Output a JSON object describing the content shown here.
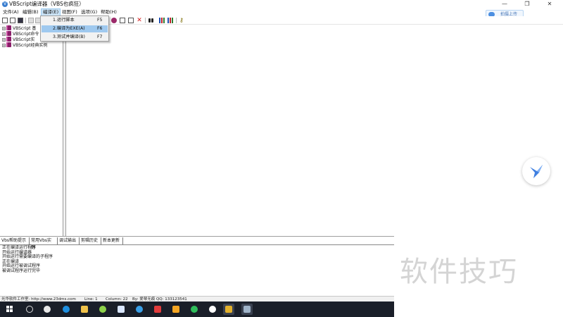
{
  "window": {
    "title": "VBScript编译器（VBS也疯狂）",
    "controls": {
      "minimize": "—",
      "maximize": "❐",
      "close": "✕"
    }
  },
  "menubar": {
    "items": [
      "文件(A)",
      "编辑(B)",
      "编译(E)",
      "视图(F)",
      "选项(G)",
      "帮助(H)"
    ]
  },
  "cloud_button": {
    "label": "拍摄上传"
  },
  "dropdown": {
    "items": [
      {
        "label": "1.运行脚本",
        "shortcut": "F5"
      },
      {
        "label": "2.编译为EXE(A)",
        "shortcut": "F6"
      },
      {
        "label": "3.测试并编译(B)",
        "shortcut": "F7"
      }
    ],
    "highlighted_index": 1
  },
  "tree": {
    "nodes": [
      "VBScript 基",
      "VBScript命令",
      "VBScript实",
      "VBScript经典实例"
    ]
  },
  "bottom_tabs": [
    "Vbs帮助提示",
    "常用Vbs实例",
    "调试输出",
    "剪辑历史",
    "新本更新"
  ],
  "output": {
    "lines": [
      "正在编译运行程序",
      "开始运行编译器",
      "开始运行需要编译的子程序",
      "正在编译",
      "开始运行被调试程序",
      "被调试程序运行完毕"
    ]
  },
  "statusbar": {
    "website": "光华软件工作室: http://www.23dms.com",
    "line": "Line: 1",
    "column": "Column: 22",
    "by": "By: 爱琴无痕 QQ: 133123541"
  },
  "watermark": "软件技巧",
  "colors": {
    "menu_highlight": "#9fc9ef",
    "taskbar": "#1a1f29",
    "accent": "#3b7fd0"
  }
}
